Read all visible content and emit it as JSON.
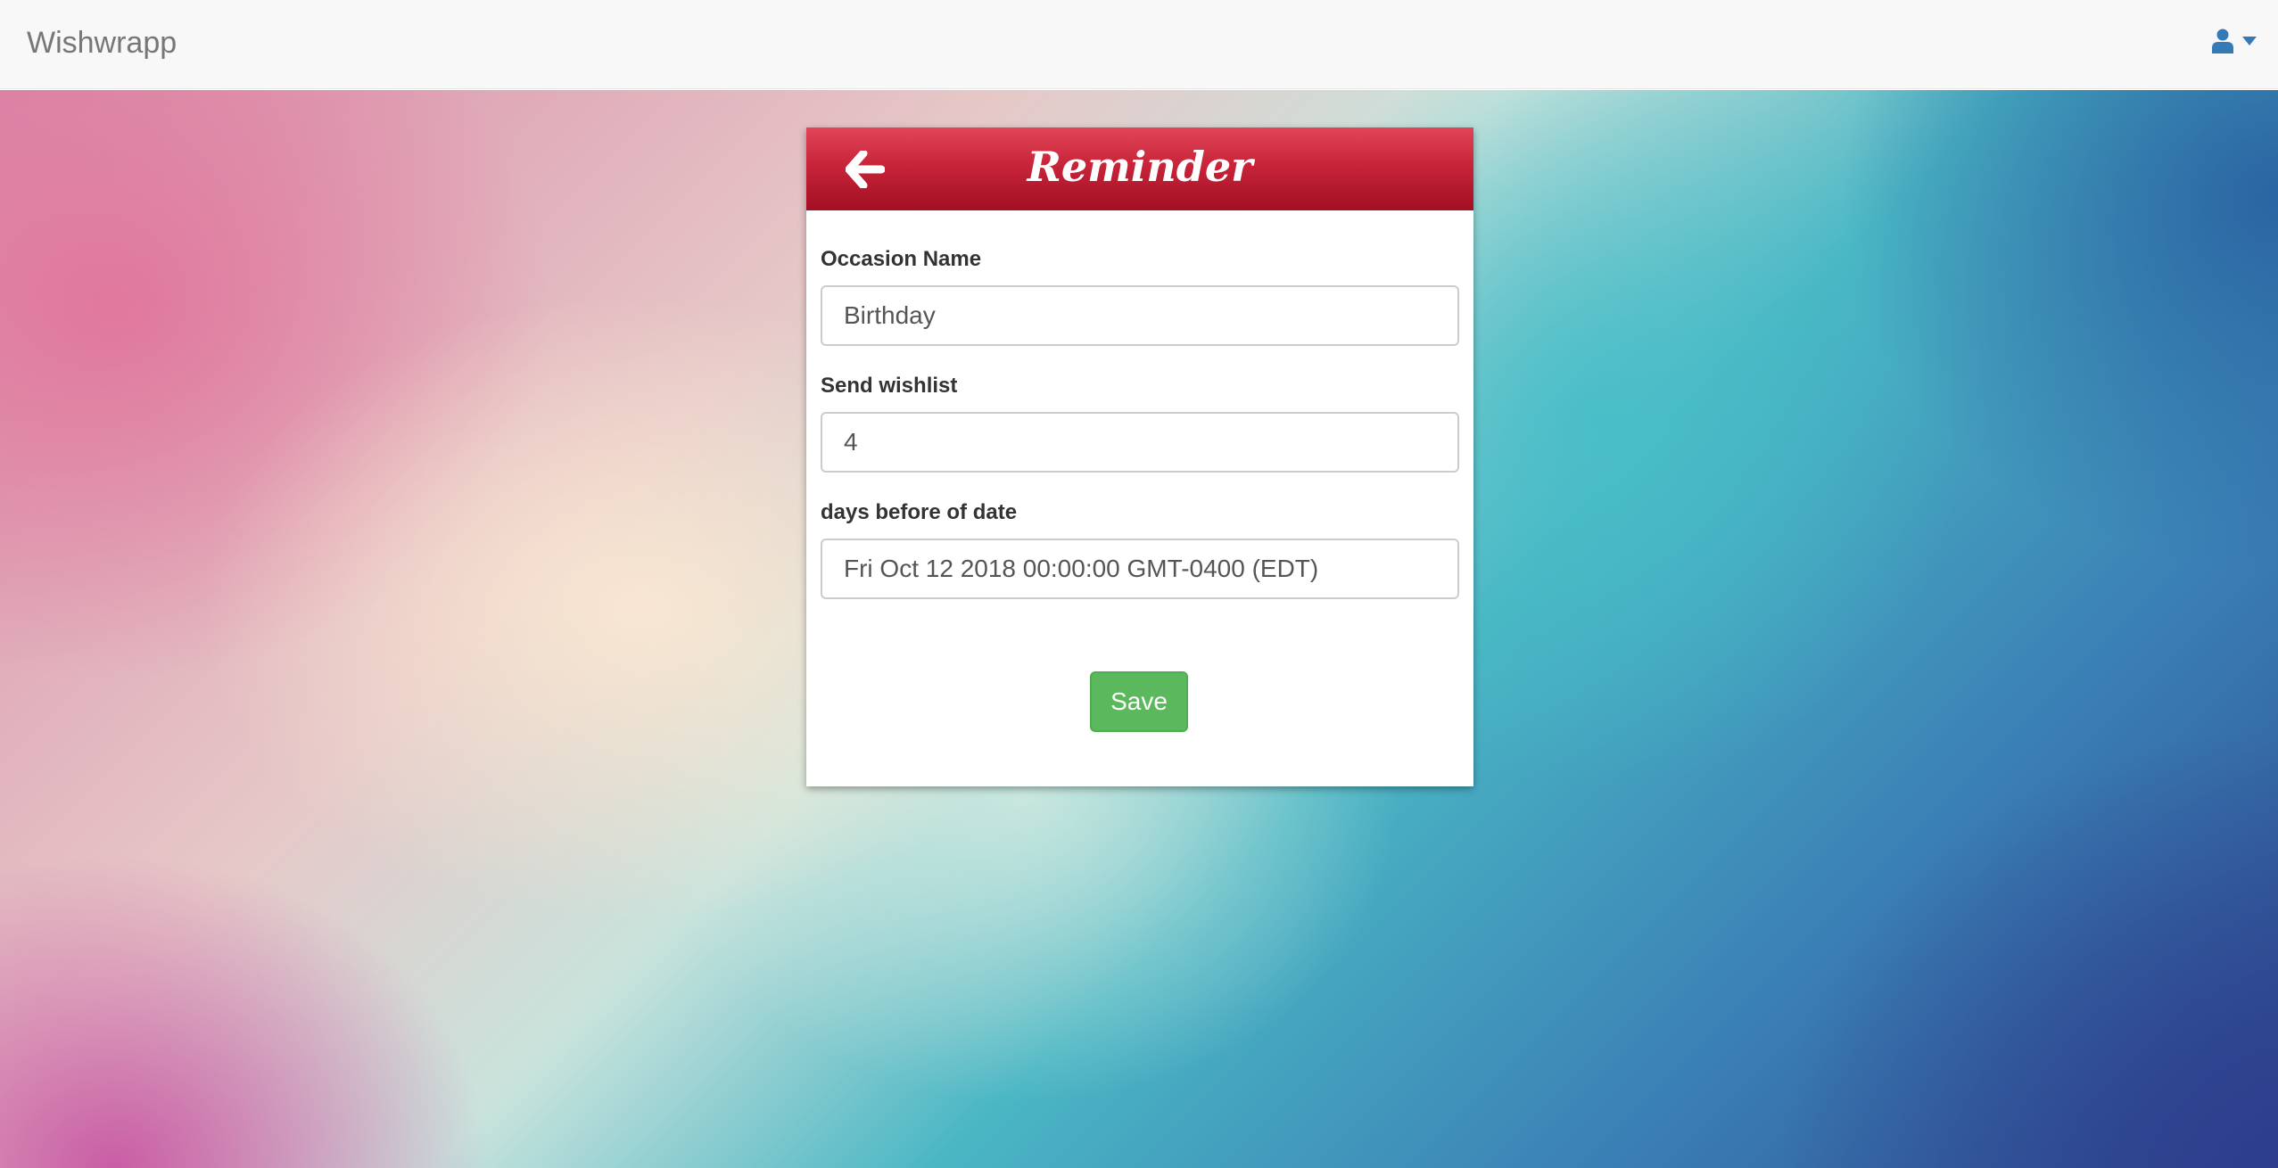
{
  "app": {
    "brand": "Wishwrapp"
  },
  "nav": {
    "user_icon": "user-icon",
    "dropdown_icon": "caret-down-icon",
    "icon_color": "#337ab7"
  },
  "card": {
    "title": "Reminder",
    "back_icon": "arrow-left-icon",
    "header_color": "#c8243a",
    "fields": [
      {
        "label": "Occasion Name",
        "value": "Birthday"
      },
      {
        "label": "Send wishlist",
        "value": "4"
      },
      {
        "label": "days before of date",
        "value": "Fri Oct 12 2018 00:00:00 GMT-0400 (EDT)"
      }
    ],
    "save_label": "Save",
    "save_color": "#5cb85c"
  }
}
